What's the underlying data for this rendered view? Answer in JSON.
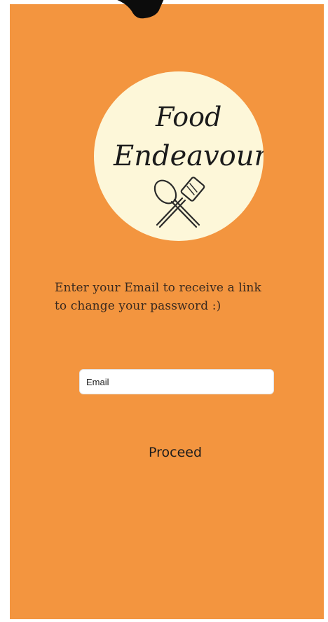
{
  "logo": {
    "line1": "Food",
    "line2": "Endeavours",
    "icon": "spoon-spatula-icon"
  },
  "prompt": {
    "line1": "Enter your Email to receive a link",
    "line2": "to change your password :)"
  },
  "email": {
    "placeholder": "Email",
    "value": ""
  },
  "proceed_label": "Proceed",
  "colors": {
    "background": "#f3953f",
    "logo_circle": "#fdf7d9",
    "text": "#3a2a1f"
  }
}
